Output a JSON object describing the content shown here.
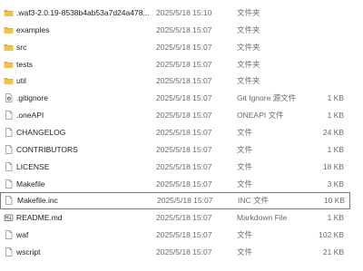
{
  "files": [
    {
      "name": ".waf3-2.0.19-8538b4ab53a7d24a478...",
      "date": "2025/5/18 15:10",
      "type": "文件夹",
      "size": "",
      "icon": "folder-icon"
    },
    {
      "name": "examples",
      "date": "2025/5/18 15:07",
      "type": "文件夹",
      "size": "",
      "icon": "folder-icon"
    },
    {
      "name": "src",
      "date": "2025/5/18 15:07",
      "type": "文件夹",
      "size": "",
      "icon": "folder-icon"
    },
    {
      "name": "tests",
      "date": "2025/5/18 15:07",
      "type": "文件夹",
      "size": "",
      "icon": "folder-icon"
    },
    {
      "name": "util",
      "date": "2025/5/18 15:07",
      "type": "文件夹",
      "size": "",
      "icon": "folder-icon"
    },
    {
      "name": ".gitignore",
      "date": "2025/5/18 15:07",
      "type": "Git Ignore 源文件",
      "size": "1 KB",
      "icon": "settings-file-icon"
    },
    {
      "name": ".oneAPI",
      "date": "2025/5/18 15:07",
      "type": "ONEAPI 文件",
      "size": "1 KB",
      "icon": "file-icon"
    },
    {
      "name": "CHANGELOG",
      "date": "2025/5/18 15:07",
      "type": "文件",
      "size": "24 KB",
      "icon": "file-icon"
    },
    {
      "name": "CONTRIBUTORS",
      "date": "2025/5/18 15:07",
      "type": "文件",
      "size": "1 KB",
      "icon": "file-icon"
    },
    {
      "name": "LICENSE",
      "date": "2025/5/18 15:07",
      "type": "文件",
      "size": "18 KB",
      "icon": "file-icon"
    },
    {
      "name": "Makefile",
      "date": "2025/5/18 15:07",
      "type": "文件",
      "size": "3 KB",
      "icon": "file-icon"
    },
    {
      "name": "Makefile.inc",
      "date": "2025/5/18 15:07",
      "type": "INC 文件",
      "size": "10 KB",
      "icon": "file-icon",
      "selected": true
    },
    {
      "name": "README.md",
      "date": "2025/5/18 15:07",
      "type": "Markdown File",
      "size": "1 KB",
      "icon": "markdown-file-icon"
    },
    {
      "name": "waf",
      "date": "2025/5/18 15:07",
      "type": "文件",
      "size": "102 KB",
      "icon": "file-icon"
    },
    {
      "name": "wscript",
      "date": "2025/5/18 15:07",
      "type": "文件",
      "size": "21 KB",
      "icon": "file-icon"
    }
  ],
  "colors": {
    "folder": "#f2c14e",
    "folder_dark": "#e0a82e",
    "selection_border": "#7a7a7a"
  }
}
